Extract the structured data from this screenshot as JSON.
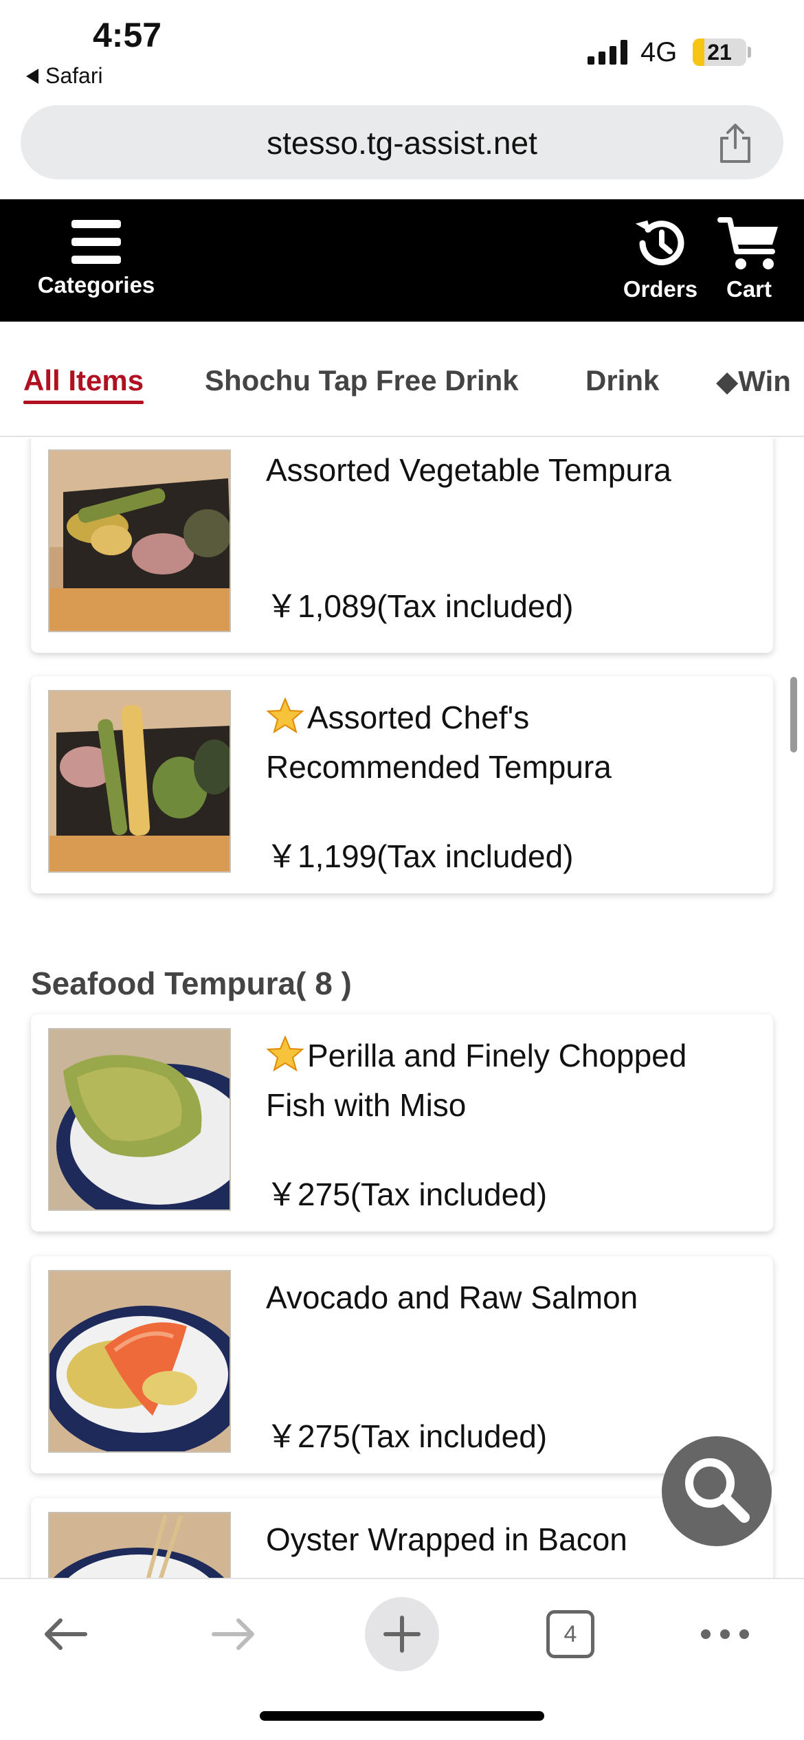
{
  "status_bar": {
    "time": "4:57",
    "back_app": "Safari",
    "network": "4G",
    "battery": "21"
  },
  "browser": {
    "url": "stesso.tg-assist.net",
    "tabs_count": "4"
  },
  "header": {
    "categories_label": "Categories",
    "orders_label": "Orders",
    "cart_label": "Cart"
  },
  "tabs": [
    "All Items",
    "Shochu Tap Free Drink",
    "Drink",
    "◆Win"
  ],
  "items": [
    {
      "name": "Assorted Vegetable Tempura",
      "price": "￥1,089(Tax included)",
      "recommended": false
    },
    {
      "name": "Assorted Chef's Recommended Tempura",
      "price": "￥1,199(Tax included)",
      "recommended": true
    }
  ],
  "section": {
    "title": "Seafood Tempura( 8 )",
    "items": [
      {
        "name": "Perilla and Finely Chopped Fish with Miso",
        "price": "￥275(Tax included)",
        "recommended": true
      },
      {
        "name": "Avocado and Raw Salmon",
        "price": "￥275(Tax included)",
        "recommended": false
      },
      {
        "name": "Oyster Wrapped in Bacon",
        "price": "",
        "recommended": false
      }
    ]
  },
  "icons": {
    "categories": "menu-icon",
    "orders": "history-icon",
    "cart": "cart-icon",
    "search": "search-icon",
    "share": "share-icon"
  },
  "colors": {
    "active_tab": "#b01020",
    "header_bg": "#000000"
  }
}
